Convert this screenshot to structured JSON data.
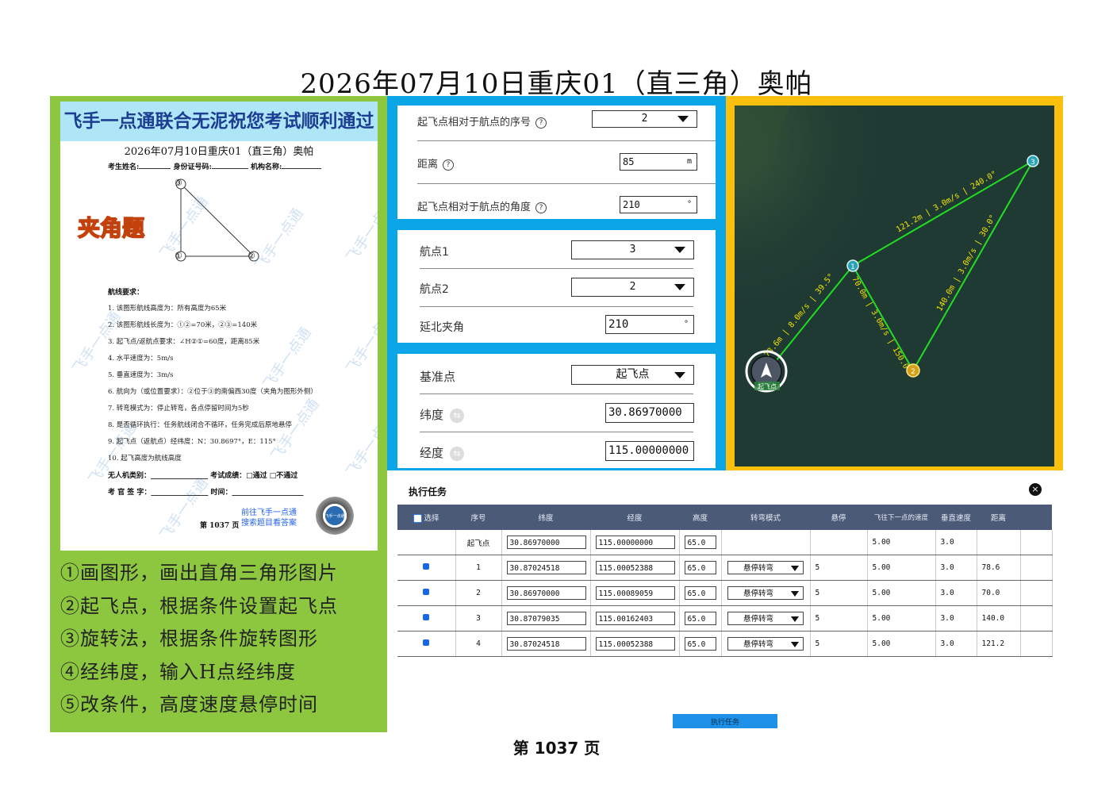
{
  "page_title": "2026年07月10日重庆01（直三角）奥帕",
  "exam_paper": {
    "banner": "飞手一点通联合无泥祝您考试顺利通过",
    "title": "2026年07月10日重庆01（直三角）奥帕",
    "fields": [
      "考生姓名:",
      "身份证号码:",
      "机构名称:"
    ],
    "triangle_labels": [
      "③",
      "①",
      "②"
    ],
    "angle_title": "夹角题",
    "watermark": "飞手一点通",
    "requirements_heading": "航线要求：",
    "requirements": [
      "1.  该图形航线高度为：所有高度为65米",
      "2.  该图形航线长度为：①②=70米，②③=140米",
      "3.  起飞点/返航点要求：∠H②①=60度，距离85米",
      "4.  水平速度为：5m/s",
      "5.  垂直速度为：3m/s",
      "6.  航向为（或位置要求）：②位于③的南偏西30度（夹角为图形外侧）",
      "7.  转弯模式为：停止转弯，各点停留时间为5秒",
      "8.  是否循环执行：任务航线闭合不循环，任务完成后原地悬停",
      "9.  起飞点（返航点）经纬度：N：30.8697°，E：115°",
      "10. 起飞高度为航线高度"
    ],
    "footer_rows": [
      "无人机类别：________________  考试成绩：□通过   □不通过",
      "考 官 签 字：________________  时间：____________________"
    ],
    "promo": [
      "前往飞手一点通",
      "搜索题目看答案"
    ],
    "page_label": "第 1037 页",
    "qr_label": "飞手一点通"
  },
  "steps": [
    "①画图形，画出直角三角形图片",
    "②起飞点，根据条件设置起飞点",
    "③旋转法，根据条件旋转图形",
    "④经纬度，输入H点经纬度",
    "⑤改条件，高度速度悬停时间"
  ],
  "takeoff_settings": {
    "seq_label": "起飞点相对于航点的序号",
    "seq_value": "2",
    "distance_label": "距离",
    "distance_value": "85",
    "distance_unit": "m",
    "angle_label": "起飞点相对于航点的角度",
    "angle_value": "210",
    "angle_unit": "°",
    "help_glyph": "?"
  },
  "rotation": {
    "wp1_label": "航点1",
    "wp1_value": "3",
    "wp2_label": "航点2",
    "wp2_value": "2",
    "north_label": "延北夹角",
    "north_value": "210",
    "north_unit": "°"
  },
  "coords": {
    "ref_label": "基准点",
    "ref_value": "起飞点",
    "lat_label": "纬度",
    "lat_value": "30.86970000",
    "lon_label": "经度",
    "lon_value": "115.00000000"
  },
  "map": {
    "waypoints": [
      "1",
      "2",
      "3"
    ],
    "takeoff_label": "起飞点",
    "seg_labels": [
      "121.2m | 3.0m/s | 240.0°",
      "140.0m | 3.0m/s | 30.0°",
      "70.0m | 3.0m/s | 150.0°",
      "78.6m | 8.0m/s | 39.5°"
    ],
    "colors": {
      "route": "#22dd22",
      "label": "#f2e400",
      "wp": "#2aa3b8",
      "wp_active": "#d4a017"
    }
  },
  "task": {
    "title": "执行任务",
    "close": "×",
    "columns": [
      "选择",
      "序号",
      "纬度",
      "经度",
      "高度",
      "转弯模式",
      "悬停",
      "飞往下一点的速度",
      "垂直速度",
      "距离"
    ],
    "rows": [
      {
        "seq": "起飞点",
        "lat": "30.86970000",
        "lon": "115.00000000",
        "alt": "65.0",
        "mode": "",
        "hover": "",
        "speed": "5.00",
        "vspeed": "3.0",
        "dist": ""
      },
      {
        "seq": "1",
        "lat": "30.87024518",
        "lon": "115.00052388",
        "alt": "65.0",
        "mode": "悬停转弯",
        "hover": "5",
        "speed": "5.00",
        "vspeed": "3.0",
        "dist": "78.6"
      },
      {
        "seq": "2",
        "lat": "30.86970000",
        "lon": "115.00089059",
        "alt": "65.0",
        "mode": "悬停转弯",
        "hover": "5",
        "speed": "5.00",
        "vspeed": "3.0",
        "dist": "70.0"
      },
      {
        "seq": "3",
        "lat": "30.87079035",
        "lon": "115.00162403",
        "alt": "65.0",
        "mode": "悬停转弯",
        "hover": "5",
        "speed": "5.00",
        "vspeed": "3.0",
        "dist": "140.0"
      },
      {
        "seq": "4",
        "lat": "30.87024518",
        "lon": "115.00052388",
        "alt": "65.0",
        "mode": "悬停转弯",
        "hover": "5",
        "speed": "5.00",
        "vspeed": "3.0",
        "dist": "121.2"
      }
    ],
    "execute_label": "执行任务"
  },
  "footer": "第 1037 页"
}
